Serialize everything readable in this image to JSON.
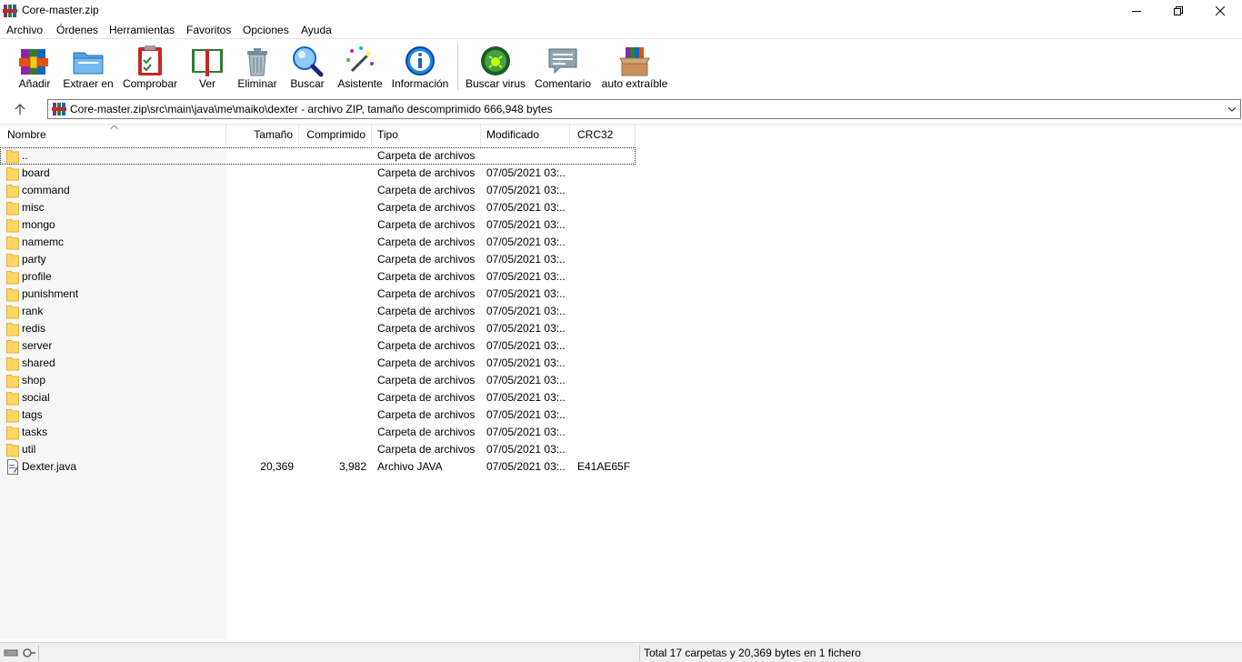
{
  "window": {
    "title": "Core-master.zip"
  },
  "menu": [
    "Archivo",
    "Órdenes",
    "Herramientas",
    "Favoritos",
    "Opciones",
    "Ayuda"
  ],
  "toolbar": [
    {
      "label": "Añadir",
      "icon": "add-archive-icon"
    },
    {
      "label": "Extraer en",
      "icon": "extract-folder-icon"
    },
    {
      "label": "Comprobar",
      "icon": "test-clipboard-icon"
    },
    {
      "label": "Ver",
      "icon": "view-book-icon"
    },
    {
      "label": "Eliminar",
      "icon": "trash-icon"
    },
    {
      "label": "Buscar",
      "icon": "magnifier-icon"
    },
    {
      "label": "Asistente",
      "icon": "wizard-wand-icon"
    },
    {
      "label": "Información",
      "icon": "info-icon"
    },
    {
      "label": "Buscar virus",
      "icon": "virus-scan-icon"
    },
    {
      "label": "Comentario",
      "icon": "comment-icon"
    },
    {
      "label": "auto extraíble",
      "icon": "sfx-box-icon"
    }
  ],
  "address": {
    "path": "Core-master.zip\\src\\main\\java\\me\\maiko\\dexter - archivo ZIP, tamaño descomprimido 666,948 bytes"
  },
  "columns": {
    "name": "Nombre",
    "size": "Tamaño",
    "compressed": "Comprimido",
    "type": "Tipo",
    "modified": "Modificado",
    "crc": "CRC32"
  },
  "files": [
    {
      "name": "..",
      "size": "",
      "compressed": "",
      "type": "Carpeta de archivos",
      "modified": "",
      "crc": "",
      "kind": "folder"
    },
    {
      "name": "board",
      "size": "",
      "compressed": "",
      "type": "Carpeta de archivos",
      "modified": "07/05/2021 03:...",
      "crc": "",
      "kind": "folder"
    },
    {
      "name": "command",
      "size": "",
      "compressed": "",
      "type": "Carpeta de archivos",
      "modified": "07/05/2021 03:...",
      "crc": "",
      "kind": "folder"
    },
    {
      "name": "misc",
      "size": "",
      "compressed": "",
      "type": "Carpeta de archivos",
      "modified": "07/05/2021 03:...",
      "crc": "",
      "kind": "folder"
    },
    {
      "name": "mongo",
      "size": "",
      "compressed": "",
      "type": "Carpeta de archivos",
      "modified": "07/05/2021 03:...",
      "crc": "",
      "kind": "folder"
    },
    {
      "name": "namemc",
      "size": "",
      "compressed": "",
      "type": "Carpeta de archivos",
      "modified": "07/05/2021 03:...",
      "crc": "",
      "kind": "folder"
    },
    {
      "name": "party",
      "size": "",
      "compressed": "",
      "type": "Carpeta de archivos",
      "modified": "07/05/2021 03:...",
      "crc": "",
      "kind": "folder"
    },
    {
      "name": "profile",
      "size": "",
      "compressed": "",
      "type": "Carpeta de archivos",
      "modified": "07/05/2021 03:...",
      "crc": "",
      "kind": "folder"
    },
    {
      "name": "punishment",
      "size": "",
      "compressed": "",
      "type": "Carpeta de archivos",
      "modified": "07/05/2021 03:...",
      "crc": "",
      "kind": "folder"
    },
    {
      "name": "rank",
      "size": "",
      "compressed": "",
      "type": "Carpeta de archivos",
      "modified": "07/05/2021 03:...",
      "crc": "",
      "kind": "folder"
    },
    {
      "name": "redis",
      "size": "",
      "compressed": "",
      "type": "Carpeta de archivos",
      "modified": "07/05/2021 03:...",
      "crc": "",
      "kind": "folder"
    },
    {
      "name": "server",
      "size": "",
      "compressed": "",
      "type": "Carpeta de archivos",
      "modified": "07/05/2021 03:...",
      "crc": "",
      "kind": "folder"
    },
    {
      "name": "shared",
      "size": "",
      "compressed": "",
      "type": "Carpeta de archivos",
      "modified": "07/05/2021 03:...",
      "crc": "",
      "kind": "folder"
    },
    {
      "name": "shop",
      "size": "",
      "compressed": "",
      "type": "Carpeta de archivos",
      "modified": "07/05/2021 03:...",
      "crc": "",
      "kind": "folder"
    },
    {
      "name": "social",
      "size": "",
      "compressed": "",
      "type": "Carpeta de archivos",
      "modified": "07/05/2021 03:...",
      "crc": "",
      "kind": "folder"
    },
    {
      "name": "tags",
      "size": "",
      "compressed": "",
      "type": "Carpeta de archivos",
      "modified": "07/05/2021 03:...",
      "crc": "",
      "kind": "folder"
    },
    {
      "name": "tasks",
      "size": "",
      "compressed": "",
      "type": "Carpeta de archivos",
      "modified": "07/05/2021 03:...",
      "crc": "",
      "kind": "folder"
    },
    {
      "name": "util",
      "size": "",
      "compressed": "",
      "type": "Carpeta de archivos",
      "modified": "07/05/2021 03:...",
      "crc": "",
      "kind": "folder"
    },
    {
      "name": "Dexter.java",
      "size": "20,369",
      "compressed": "3,982",
      "type": "Archivo JAVA",
      "modified": "07/05/2021 03:...",
      "crc": "E41AE65F",
      "kind": "java-file"
    }
  ],
  "status": {
    "text": "Total 17 carpetas y 20,369 bytes en 1 fichero"
  }
}
